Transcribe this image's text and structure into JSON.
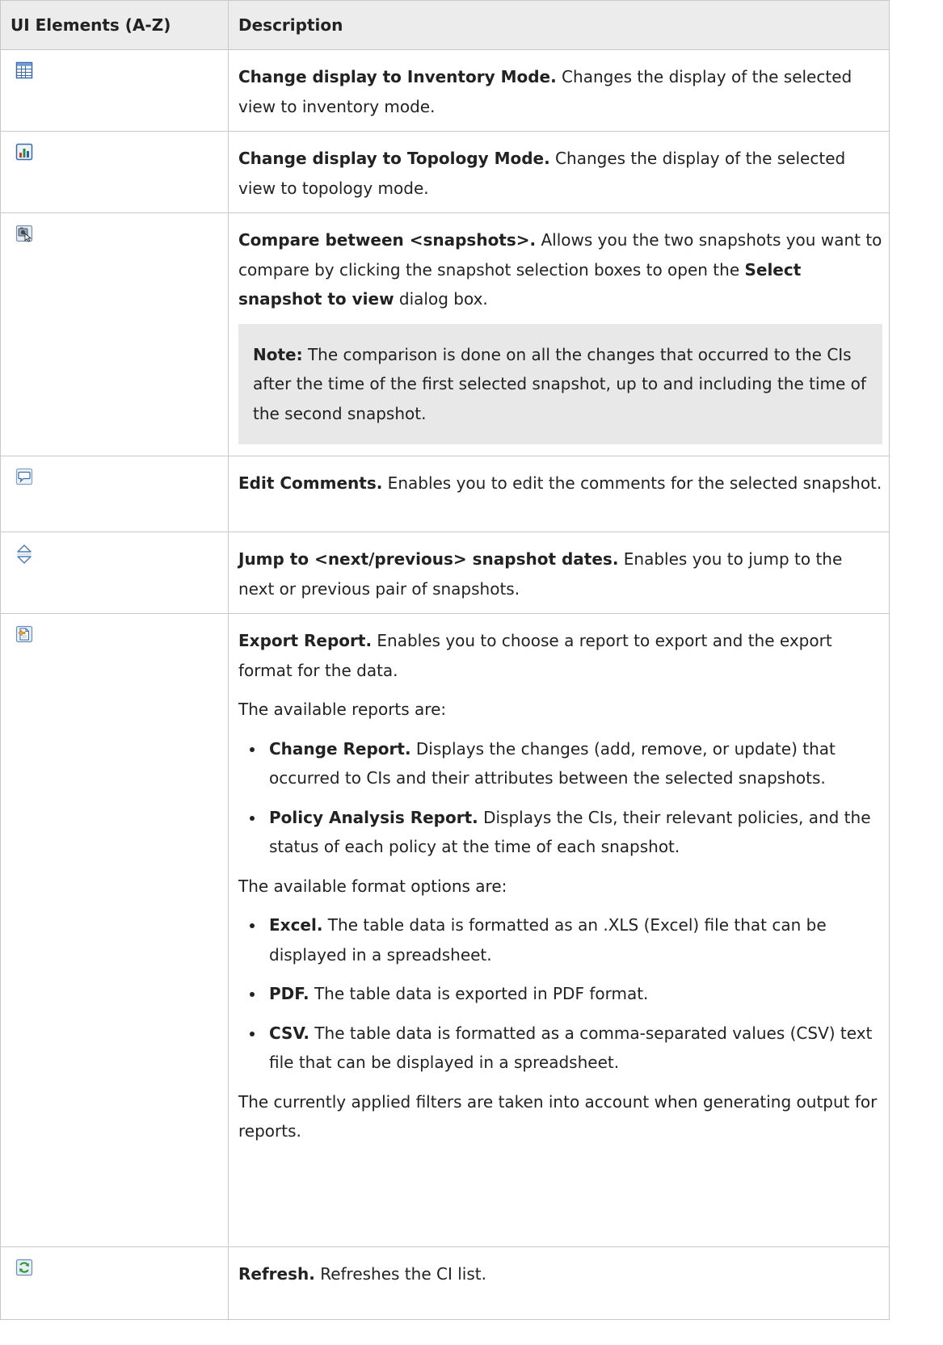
{
  "table": {
    "header": {
      "col1": "UI Elements (A-Z)",
      "col2": "Description"
    },
    "rows": [
      {
        "icon": "inventory-mode-grid-icon",
        "bold": "Change display to Inventory Mode.",
        "text": " Changes the display of the selected view to inventory mode."
      },
      {
        "icon": "topology-mode-chart-icon",
        "bold": "Change display to Topology Mode.",
        "text": " Changes the display of the selected view to topology mode."
      },
      {
        "icon": "compare-snapshots-icon",
        "bold": "Compare between <snapshots>.",
        "text1": " Allows you the two snapshots you want to compare by clicking the snapshot selection boxes to open the ",
        "bold2": "Select snapshot to view",
        "text2": " dialog box.",
        "note_label": "Note:",
        "note_text": " The comparison is done on all the changes that occurred to the CIs after the time of the first selected snapshot, up to and including the time of the second snapshot."
      },
      {
        "icon": "edit-comments-speech-bubble-icon",
        "bold": "Edit Comments.",
        "text": " Enables you to edit the comments for the selected snapshot."
      },
      {
        "icon": "jump-up-down-arrows-icon",
        "bold": "Jump to <next/previous> snapshot dates.",
        "text": " Enables you to jump to the next or previous pair of snapshots."
      },
      {
        "icon": "export-report-icon",
        "bold": "Export Report.",
        "text": " Enables you to choose a report to export and the export format for the data.",
        "reports_intro": "The available reports are:",
        "reports": [
          {
            "bold": "Change Report.",
            "text": " Displays the changes (add, remove, or update) that occurred to CIs and their attributes between the selected snapshots."
          },
          {
            "bold": "Policy Analysis Report.",
            "text": " Displays the CIs, their relevant policies, and the status of each policy at the time of each snapshot."
          }
        ],
        "formats_intro": "The available format options are:",
        "formats": [
          {
            "bold": "Excel.",
            "text": " The table data is formatted as an .XLS (Excel) file that can be displayed in a spreadsheet."
          },
          {
            "bold": "PDF.",
            "text": " The table data is exported in PDF format."
          },
          {
            "bold": "CSV.",
            "text": " The table data is formatted as a comma-separated values (CSV) text file that can be displayed in a spreadsheet."
          }
        ],
        "closing": "The currently applied filters are taken into account when generating output for reports."
      },
      {
        "icon": "refresh-icon",
        "bold": "Refresh.",
        "text": " Refreshes the CI list."
      }
    ]
  }
}
